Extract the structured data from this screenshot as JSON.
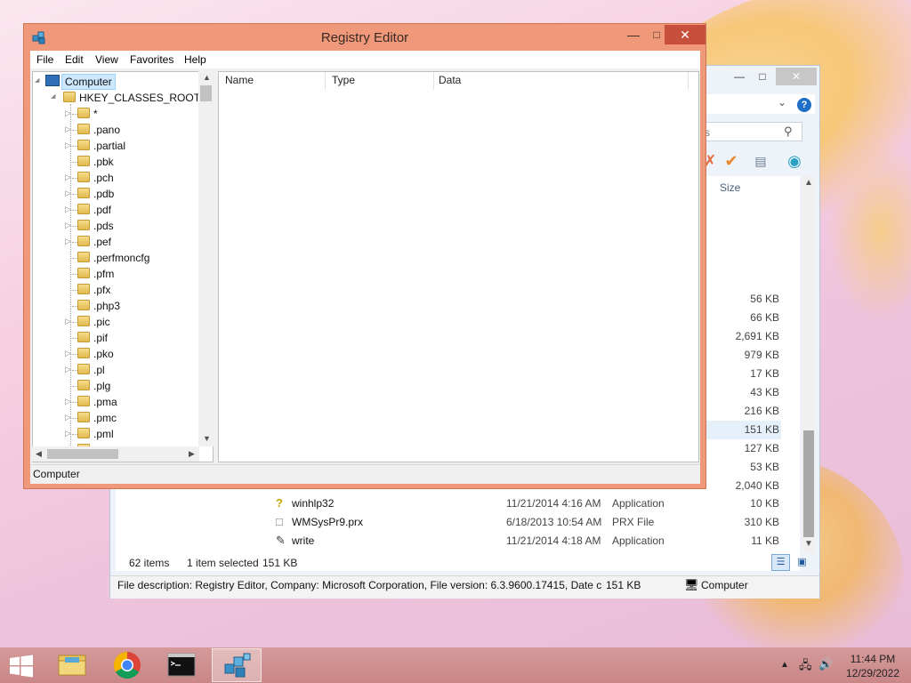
{
  "regedit": {
    "title": "Registry Editor",
    "menu": [
      "File",
      "Edit",
      "View",
      "Favorites",
      "Help"
    ],
    "tree": {
      "root": "Computer",
      "hive": "HKEY_CLASSES_ROOT",
      "keys": [
        ".*",
        ".pano",
        ".partial",
        ".pbk",
        ".pch",
        ".pdb",
        ".pdf",
        ".pds",
        ".pef",
        ".perfmoncfg",
        ".pfm",
        ".pfx",
        ".php3",
        ".pic",
        ".pif",
        ".pko",
        ".pl",
        ".plg",
        ".pma",
        ".pmc",
        ".pml",
        ".pmr"
      ],
      "keys_display": [
        "*",
        ".pano",
        ".partial",
        ".pbk",
        ".pch",
        ".pdb",
        ".pdf",
        ".pds",
        ".pef",
        ".perfmoncfg",
        ".pfm",
        ".pfx",
        ".php3",
        ".pic",
        ".pif",
        ".pko",
        ".pl",
        ".plg",
        ".pma",
        ".pmc",
        ".pml",
        ".pmr"
      ]
    },
    "columns": {
      "name": "Name",
      "type": "Type",
      "data": "Data"
    },
    "status": "Computer"
  },
  "explorer": {
    "column_size": "Size",
    "search_placeholder": "s",
    "sizes": [
      "56 KB",
      "66 KB",
      "2,691 KB",
      "979 KB",
      "17 KB",
      "43 KB",
      "216 KB",
      "151 KB",
      "127 KB",
      "53 KB",
      "2,040 KB"
    ],
    "files": [
      {
        "name": "winhlp32",
        "date": "11/21/2014 4:16 AM",
        "type": "Application",
        "size": "10 KB",
        "icon": "help-file-icon"
      },
      {
        "name": "WMSysPr9.prx",
        "date": "6/18/2013 10:54 AM",
        "type": "PRX File",
        "size": "310 KB",
        "icon": "document-icon"
      },
      {
        "name": "write",
        "date": "11/21/2014 4:18 AM",
        "type": "Application",
        "size": "11 KB",
        "icon": "write-app-icon"
      }
    ],
    "status": {
      "count": "62 items",
      "selected": "1 item selected",
      "selected_size": "151 KB"
    },
    "details": {
      "description": "File description: Registry Editor, Company: Microsoft Corporation, File version: 6.3.9600.17415, Date crea",
      "size": "151 KB",
      "computer": "Computer"
    }
  },
  "taskbar": {
    "apps": [
      "File Explorer",
      "Google Chrome",
      "Command Prompt",
      "Registry Editor"
    ],
    "time": "11:44 PM",
    "date": "12/29/2022"
  },
  "colors": {
    "regedit_frame": "#f0987a",
    "close_button": "#c7503c",
    "taskbar": "#cc8f8f",
    "selection": "#cce8ff"
  }
}
